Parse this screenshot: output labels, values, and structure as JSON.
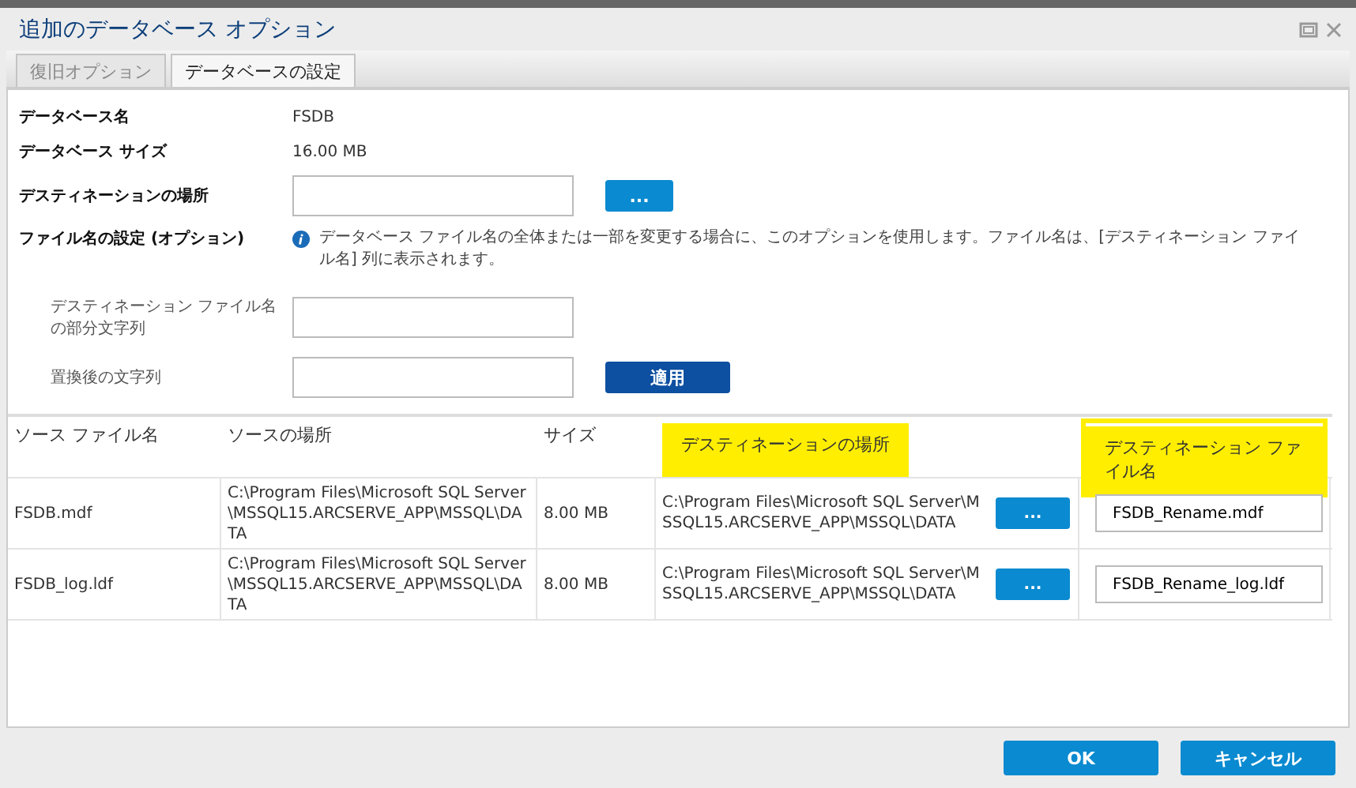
{
  "window": {
    "title": "追加のデータベース オプション"
  },
  "tabs": [
    {
      "label": "復旧オプション",
      "selected": false
    },
    {
      "label": "データベースの設定",
      "selected": true
    }
  ],
  "form": {
    "database_name": {
      "label": "データベース名",
      "value": "FSDB"
    },
    "database_size": {
      "label": "データベース サイズ",
      "value": "16.00 MB"
    },
    "destination": {
      "label": "デスティネーションの場所",
      "browse": "..."
    },
    "file_name_settings": {
      "label": "ファイル名の設定 (オプション)",
      "info": "データベース ファイル名の全体または一部を変更する場合に、このオプションを使用します。ファイル名は、[デスティネーション ファイル名] 列に表示されます。"
    },
    "partial_string": {
      "label": "デスティネーション ファイル名の部分文字列"
    },
    "replacement": {
      "label": "置換後の文字列",
      "apply": "適用"
    }
  },
  "table": {
    "columns": [
      {
        "label": "ソース ファイル名",
        "highlighted": false
      },
      {
        "label": "ソースの場所",
        "highlighted": false
      },
      {
        "label": "サイズ",
        "highlighted": false
      },
      {
        "label": "デスティネーションの場所",
        "highlighted": true
      },
      {
        "label": "デスティネーション ファイル名",
        "highlighted": true
      }
    ],
    "rows": [
      {
        "source_file": "FSDB.mdf",
        "source_location": "C:\\Program Files\\Microsoft SQL Server\\MSSQL15.ARCSERVE_APP\\MSSQL\\DATA",
        "size": "8.00 MB",
        "destination": "C:\\Program Files\\Microsoft SQL Server\\MSSQL15.ARCSERVE_APP\\MSSQL\\DATA",
        "browse": "...",
        "file_name": "FSDB_Rename.mdf"
      },
      {
        "source_file": "FSDB_log.ldf",
        "source_location": "C:\\Program Files\\Microsoft SQL Server\\MSSQL15.ARCSERVE_APP\\MSSQL\\DATA",
        "size": "8.00 MB",
        "destination": "C:\\Program Files\\Microsoft SQL Server\\MSSQL15.ARCSERVE_APP\\MSSQL\\DATA",
        "browse": "...",
        "file_name": "FSDB_Rename_log.ldf"
      }
    ]
  },
  "buttons": [
    {
      "label": "OK"
    },
    {
      "label": "キャンセル"
    }
  ]
}
